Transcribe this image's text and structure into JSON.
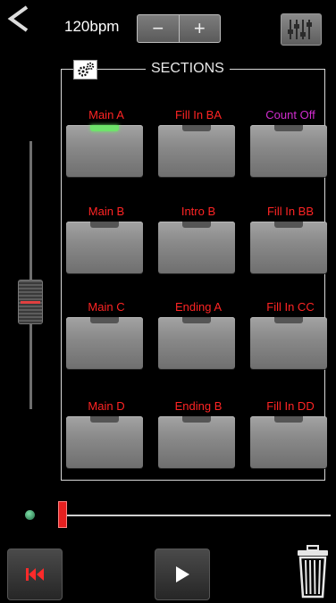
{
  "header": {
    "tempo_label": "120bpm",
    "decrease_label": "−",
    "increase_label": "+"
  },
  "sections": {
    "title": "SECTIONS",
    "pads": [
      {
        "label": "Main A",
        "color": "#ff2424",
        "active": true
      },
      {
        "label": "Fill In BA",
        "color": "#ff2424",
        "active": false
      },
      {
        "label": "Count Off",
        "color": "#d12ccf",
        "active": false
      },
      {
        "label": "Main B",
        "color": "#ff2424",
        "active": false
      },
      {
        "label": "Intro B",
        "color": "#ff2424",
        "active": false
      },
      {
        "label": "Fill In BB",
        "color": "#ff2424",
        "active": false
      },
      {
        "label": "Main C",
        "color": "#ff2424",
        "active": false
      },
      {
        "label": "Ending A",
        "color": "#ff2424",
        "active": false
      },
      {
        "label": "Fill In CC",
        "color": "#ff2424",
        "active": false
      },
      {
        "label": "Main D",
        "color": "#ff2424",
        "active": false
      },
      {
        "label": "Ending B",
        "color": "#ff2424",
        "active": false
      },
      {
        "label": "Fill In DD",
        "color": "#ff2424",
        "active": false
      }
    ]
  },
  "icons": {
    "back": "chevron-left-icon",
    "mixer": "sliders-icon",
    "settings": "gears-icon",
    "rewind": "skip-back-icon",
    "play": "play-icon",
    "trash": "trash-icon"
  },
  "volume_fader": {
    "level": 0.38
  },
  "playback": {
    "progress": 0.0
  },
  "colors": {
    "accent_red": "#ff2424",
    "count_off": "#d12ccf",
    "active_led": "#6fe36b"
  }
}
